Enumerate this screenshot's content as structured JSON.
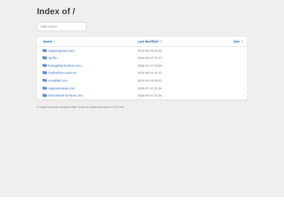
{
  "page": {
    "title": "Index of /"
  },
  "filter": {
    "placeholder": "Filter Name"
  },
  "table": {
    "headers": {
      "name": "Name",
      "modified": "Last Modified",
      "size": "Size"
    },
    "sort_icon_name": "sort-arrows-icon",
    "rows": [
      {
        "name": "caygiongsonnl.com",
        "modified": "2024-06-25 01:26",
        "size": "-"
      },
      {
        "name": "cgi-bin",
        "modified": "2024-04-27 01:47",
        "size": "-"
      },
      {
        "name": "hoangphat-furniture.com",
        "modified": "2024-07-07 03:26",
        "size": "-"
      },
      {
        "name": "mathanhtra.name.vn",
        "modified": "2024-06-26 11:17",
        "size": "-"
      },
      {
        "name": "mosqhatf.com",
        "modified": "2024-04-26 09:13",
        "size": "-"
      },
      {
        "name": "ngdamvietnam.com",
        "modified": "2024-07-11 12:43",
        "size": "-"
      },
      {
        "name": "thienduhinh-furniture.com",
        "modified": "2024-04-27 01:46",
        "size": "-"
      }
    ]
  },
  "footer": {
    "text": "Proudly Served by LiteSpeed Web Server at mathanhtra.name.vn Port 443"
  },
  "colors": {
    "link": "#2a6dc0",
    "folder_icon": "#5a8fd6",
    "background": "#efefef"
  }
}
